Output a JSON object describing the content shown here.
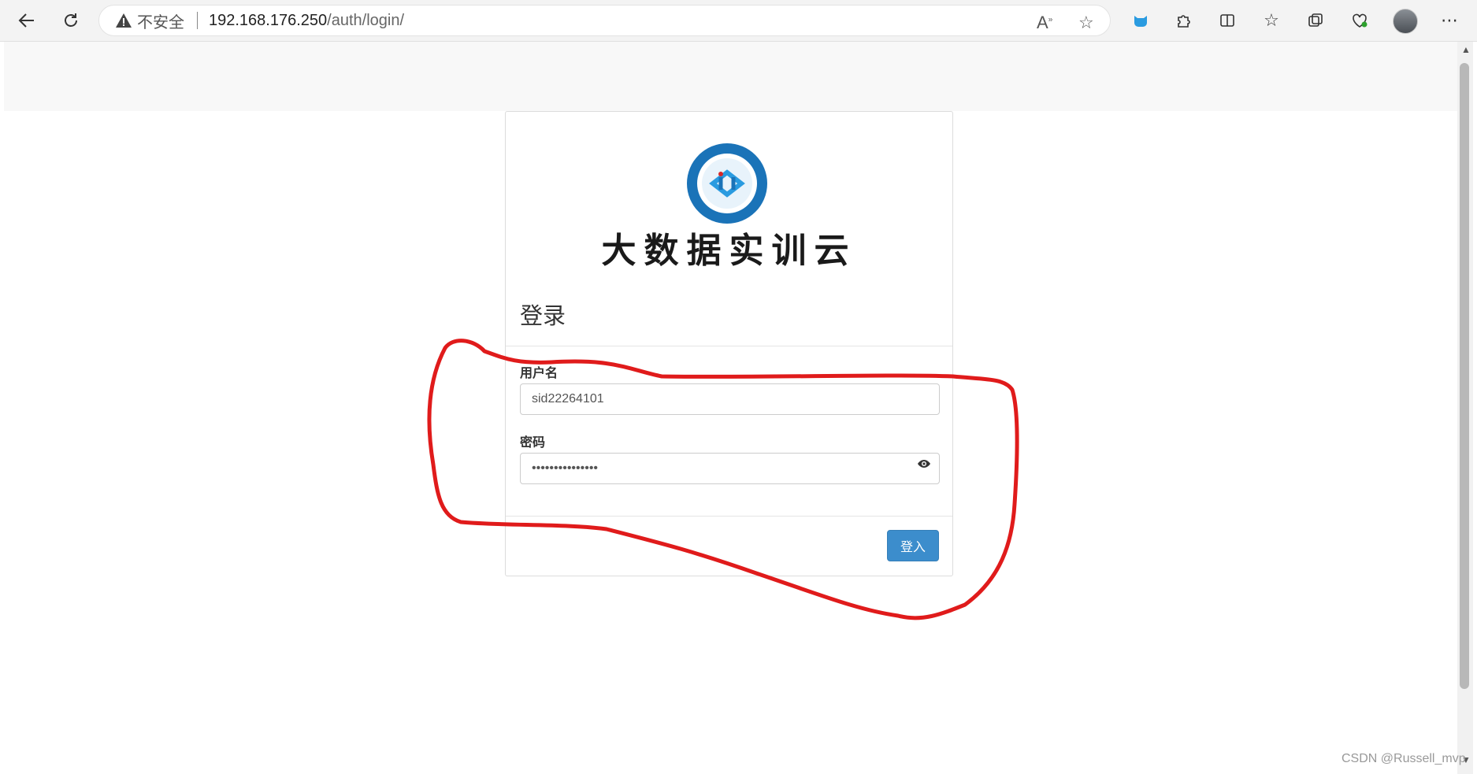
{
  "browser": {
    "security_label": "不安全",
    "url_host": "192.168.176.250",
    "url_path": "/auth/login/",
    "icons": [
      "back-icon",
      "refresh-icon",
      "warning-icon",
      "read-aloud-icon",
      "favorite-star-icon",
      "extension-cat-icon",
      "extensions-puzzle-icon",
      "split-screen-icon",
      "favorites-icon",
      "collections-icon",
      "browser-essentials-icon",
      "profile-avatar",
      "more-menu-icon"
    ]
  },
  "page": {
    "site_title": "大数据实训云",
    "login_heading": "登录",
    "username_label": "用户名",
    "username_value": "sid22264101",
    "password_label": "密码",
    "password_masked": "•••••••••••••••",
    "submit_label": "登入"
  },
  "annotation": {
    "color": "#e01b1b"
  },
  "watermark": "CSDN @Russell_mvp",
  "colors": {
    "primary_button": "#3c8dcc",
    "logo_blue": "#1a73b8"
  }
}
